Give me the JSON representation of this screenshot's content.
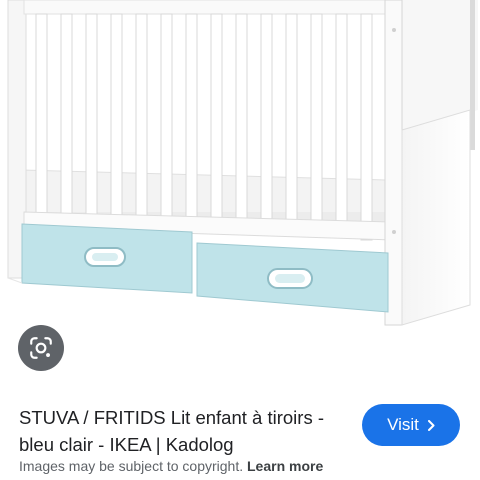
{
  "result": {
    "title": "STUVA / FRITIDS Lit enfant à tiroirs - bleu clair - IKEA | Kadolog",
    "visit_label": "Visit",
    "copyright_text": "Images may be subject to copyright.",
    "learn_more_label": "Learn more"
  },
  "icons": {
    "lens": "google-lens-icon",
    "visit": "chevron-right-icon"
  },
  "colors": {
    "visit_button": "#1a73e8",
    "lens_button": "#5f6368",
    "drawer": "#bfe3e9",
    "crib_frame": "#ffffff"
  }
}
